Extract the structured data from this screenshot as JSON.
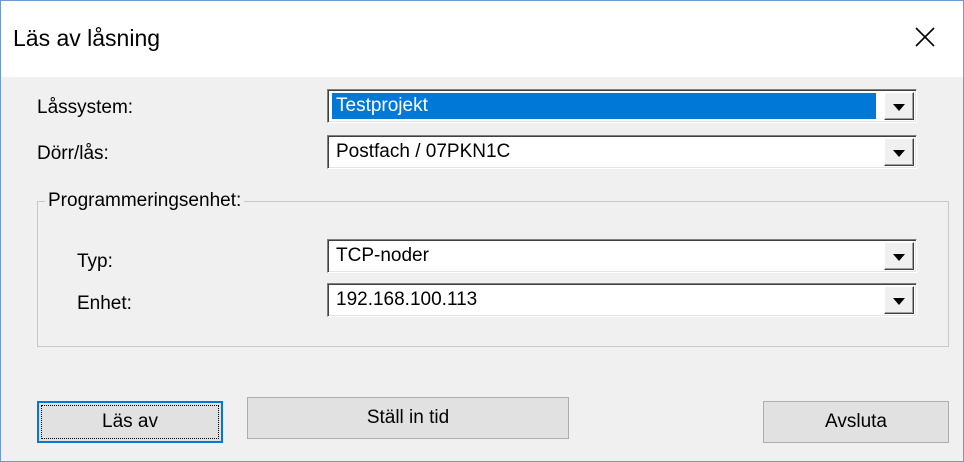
{
  "window": {
    "title": "Läs av låsning"
  },
  "fields": {
    "lock_system": {
      "label": "Låssystem:",
      "value": "Testprojekt"
    },
    "door_lock": {
      "label": "Dörr/lås:",
      "value": "Postfach / 07PKN1C"
    }
  },
  "programming_unit": {
    "legend": "Programmeringsenhet:",
    "type": {
      "label": "Typ:",
      "value": "TCP-noder"
    },
    "device": {
      "label": "Enhet:",
      "value": "192.168.100.113"
    }
  },
  "buttons": {
    "read_label": "Läs av",
    "set_time_label": "Ställ in tid",
    "exit_label": "Avsluta"
  },
  "colors": {
    "selection": "#0078d7",
    "dialog_background": "#f0f0f0",
    "button_background": "#e1e1e1"
  }
}
